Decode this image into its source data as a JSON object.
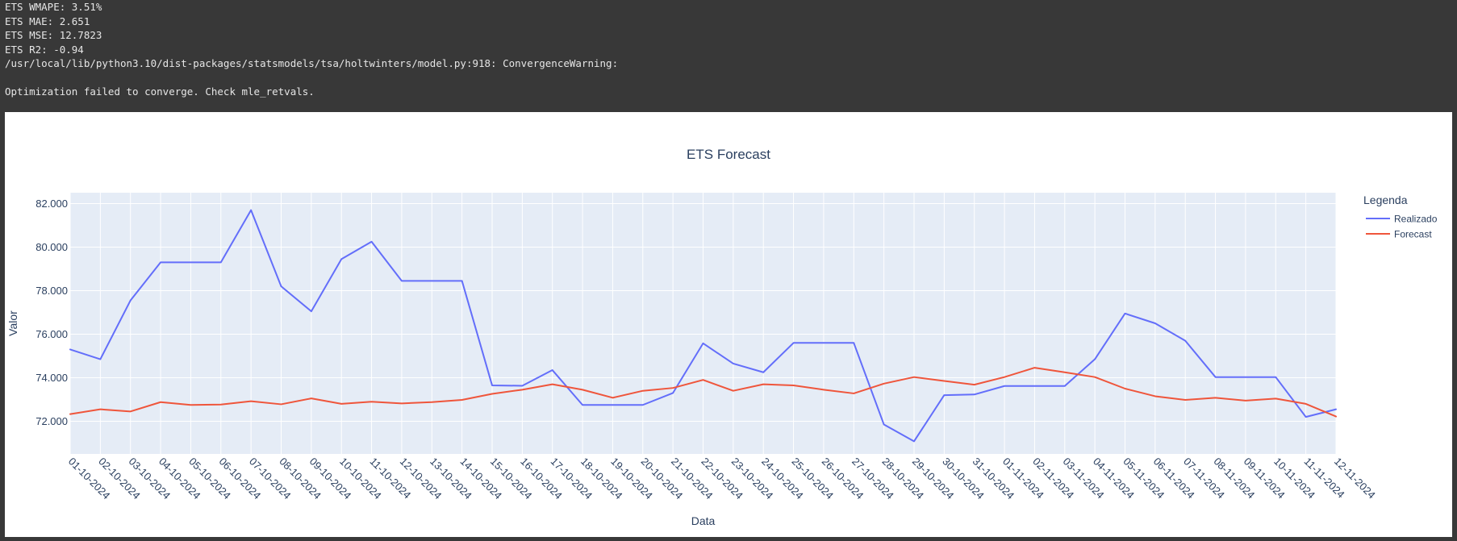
{
  "console": {
    "lines": [
      "ETS WMAPE: 3.51%",
      "ETS MAE: 2.651",
      "ETS MSE: 12.7823",
      "ETS R2: -0.94",
      "/usr/local/lib/python3.10/dist-packages/statsmodels/tsa/holtwinters/model.py:918: ConvergenceWarning:",
      "",
      "Optimization failed to converge. Check mle_retvals."
    ]
  },
  "colors": {
    "realizado": "#636efa",
    "forecast": "#ef553b",
    "plot_bg": "#e5ecf6",
    "grid": "#ffffff",
    "text": "#2a3f5f"
  },
  "chart_data": {
    "type": "line",
    "title": "ETS Forecast",
    "xlabel": "Data",
    "ylabel": "Valor",
    "ylim": [
      70.5,
      82.5
    ],
    "yticks": [
      72000,
      74000,
      76000,
      78000,
      80000,
      82000
    ],
    "ytick_labels": [
      "72.000",
      "74.000",
      "76.000",
      "78.000",
      "80.000",
      "82.000"
    ],
    "grid": true,
    "legend": {
      "title": "Legenda",
      "placement": "top-right"
    },
    "x": [
      "01-10-2024",
      "02-10-2024",
      "03-10-2024",
      "04-10-2024",
      "05-10-2024",
      "06-10-2024",
      "07-10-2024",
      "08-10-2024",
      "09-10-2024",
      "10-10-2024",
      "11-10-2024",
      "12-10-2024",
      "13-10-2024",
      "14-10-2024",
      "15-10-2024",
      "16-10-2024",
      "17-10-2024",
      "18-10-2024",
      "19-10-2024",
      "20-10-2024",
      "21-10-2024",
      "22-10-2024",
      "23-10-2024",
      "24-10-2024",
      "25-10-2024",
      "26-10-2024",
      "27-10-2024",
      "28-10-2024",
      "29-10-2024",
      "30-10-2024",
      "31-10-2024",
      "01-11-2024",
      "02-11-2024",
      "03-11-2024",
      "04-11-2024",
      "05-11-2024",
      "06-11-2024",
      "07-11-2024",
      "08-11-2024",
      "09-11-2024",
      "10-11-2024",
      "11-11-2024",
      "12-11-2024"
    ],
    "series": [
      {
        "name": "Realizado",
        "values": [
          75300,
          74850,
          77550,
          79300,
          79300,
          79300,
          81700,
          78200,
          77050,
          79450,
          80250,
          78450,
          78450,
          78450,
          73650,
          73630,
          74350,
          72750,
          72750,
          72750,
          73300,
          75580,
          74650,
          74250,
          75600,
          75600,
          75600,
          71850,
          71080,
          73200,
          73230,
          73620,
          73620,
          73620,
          74850,
          76950,
          76500,
          75700,
          74030,
          74030,
          74030,
          72200,
          72550
        ]
      },
      {
        "name": "Forecast",
        "values": [
          72330,
          72550,
          72450,
          72880,
          72750,
          72770,
          72920,
          72780,
          73050,
          72800,
          72900,
          72820,
          72880,
          72980,
          73260,
          73450,
          73700,
          73450,
          73080,
          73400,
          73530,
          73900,
          73400,
          73700,
          73650,
          73450,
          73280,
          73730,
          74030,
          73850,
          73680,
          74030,
          74460,
          74250,
          74030,
          73500,
          73150,
          72980,
          73080,
          72950,
          73040,
          72800,
          72220
        ]
      }
    ]
  }
}
